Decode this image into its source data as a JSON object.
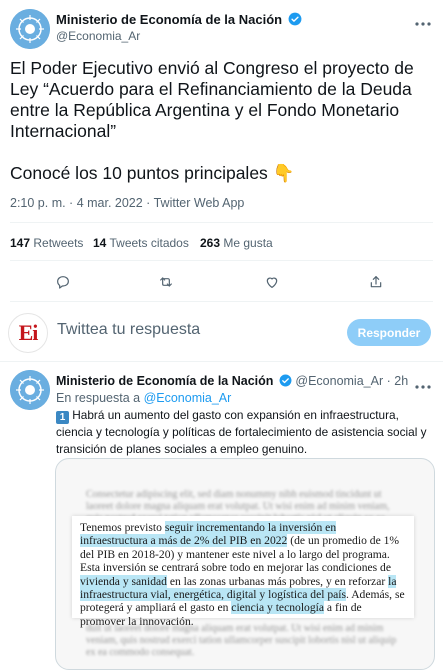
{
  "main_tweet": {
    "author_name": "Ministerio de Economía de la Nación",
    "author_handle": "@Economia_Ar",
    "text_p1": "El Poder Ejecutivo envió al Congreso el proyecto de Ley “Acuerdo para el Refinanciamiento de la Deuda entre la República Argentina y el Fondo Monetario Internacional”",
    "text_p2": "Conocé los 10 puntos principales 👇",
    "meta": "2:10 p. m. · 4 mar. 2022 · Twitter Web App",
    "stats": {
      "retweets_count": "147",
      "retweets_label": "Retweets",
      "quotes_count": "14",
      "quotes_label": "Tweets citados",
      "likes_count": "263",
      "likes_label": "Me gusta"
    }
  },
  "reply_box": {
    "avatar_text": "Ei",
    "placeholder": "Twittea tu respuesta",
    "button": "Responder"
  },
  "reply_tweet": {
    "author_name": "Ministerio de Economía de la Nación",
    "author_handle": "@Economia_Ar",
    "time": "· 2h",
    "in_reply_prefix": "En respuesta a",
    "in_reply_handle": "@Economia_Ar",
    "number_badge": "1",
    "text": "Habrá un aumento del gasto con expansión en infraestructura, ciencia y tecnología y políticas de fortalecimiento de asistencia social y transición de planes sociales a empleo genuino.",
    "image": {
      "doc_text_1": "Tenemos previsto ",
      "doc_hl_1": "seguir incrementando la inversión en infraestructura a más de 2% del PIB en 2022",
      "doc_text_2": " (de un promedio de 1% del PIB en 2018-20) y mantener este nivel a lo largo del programa. Esta inversión se centrará sobre todo en mejorar las condiciones de ",
      "doc_hl_2": "vivienda y sanidad",
      "doc_text_3": " en las zonas urbanas más pobres, y en reforzar ",
      "doc_hl_3": "la infraestructura vial, energética, digital y logística del país",
      "doc_text_4": ". Además, se protegerá y ampliará el gasto en ",
      "doc_hl_4": "ciencia y tecnología",
      "doc_text_5": " a fin de promover la innovación.",
      "blur_top": "Consectetur adipiscing elit, sed diam nonummy nibh euismod tincidunt ut laoreet dolore magna aliquam erat volutpat. Ut wisi enim ad minim veniam, quis nostrud exerci tation ullamcorper suscipit lobortis nisl ut aliquip ex ea commodo",
      "blur_bottom": "duit ut laoreet dolore magna aliquam erat volutpat. Ut wisi enim ad minim veniam, quis nostrud exerci tation ullamcorper suscipit lobortis nisl ut aliquip ex ea commodo consequat."
    }
  },
  "colors": {
    "accent": "#1d9bf0",
    "button_disabled": "#8ecdf8",
    "muted": "#536471",
    "highlight": "#b9e6f5"
  }
}
